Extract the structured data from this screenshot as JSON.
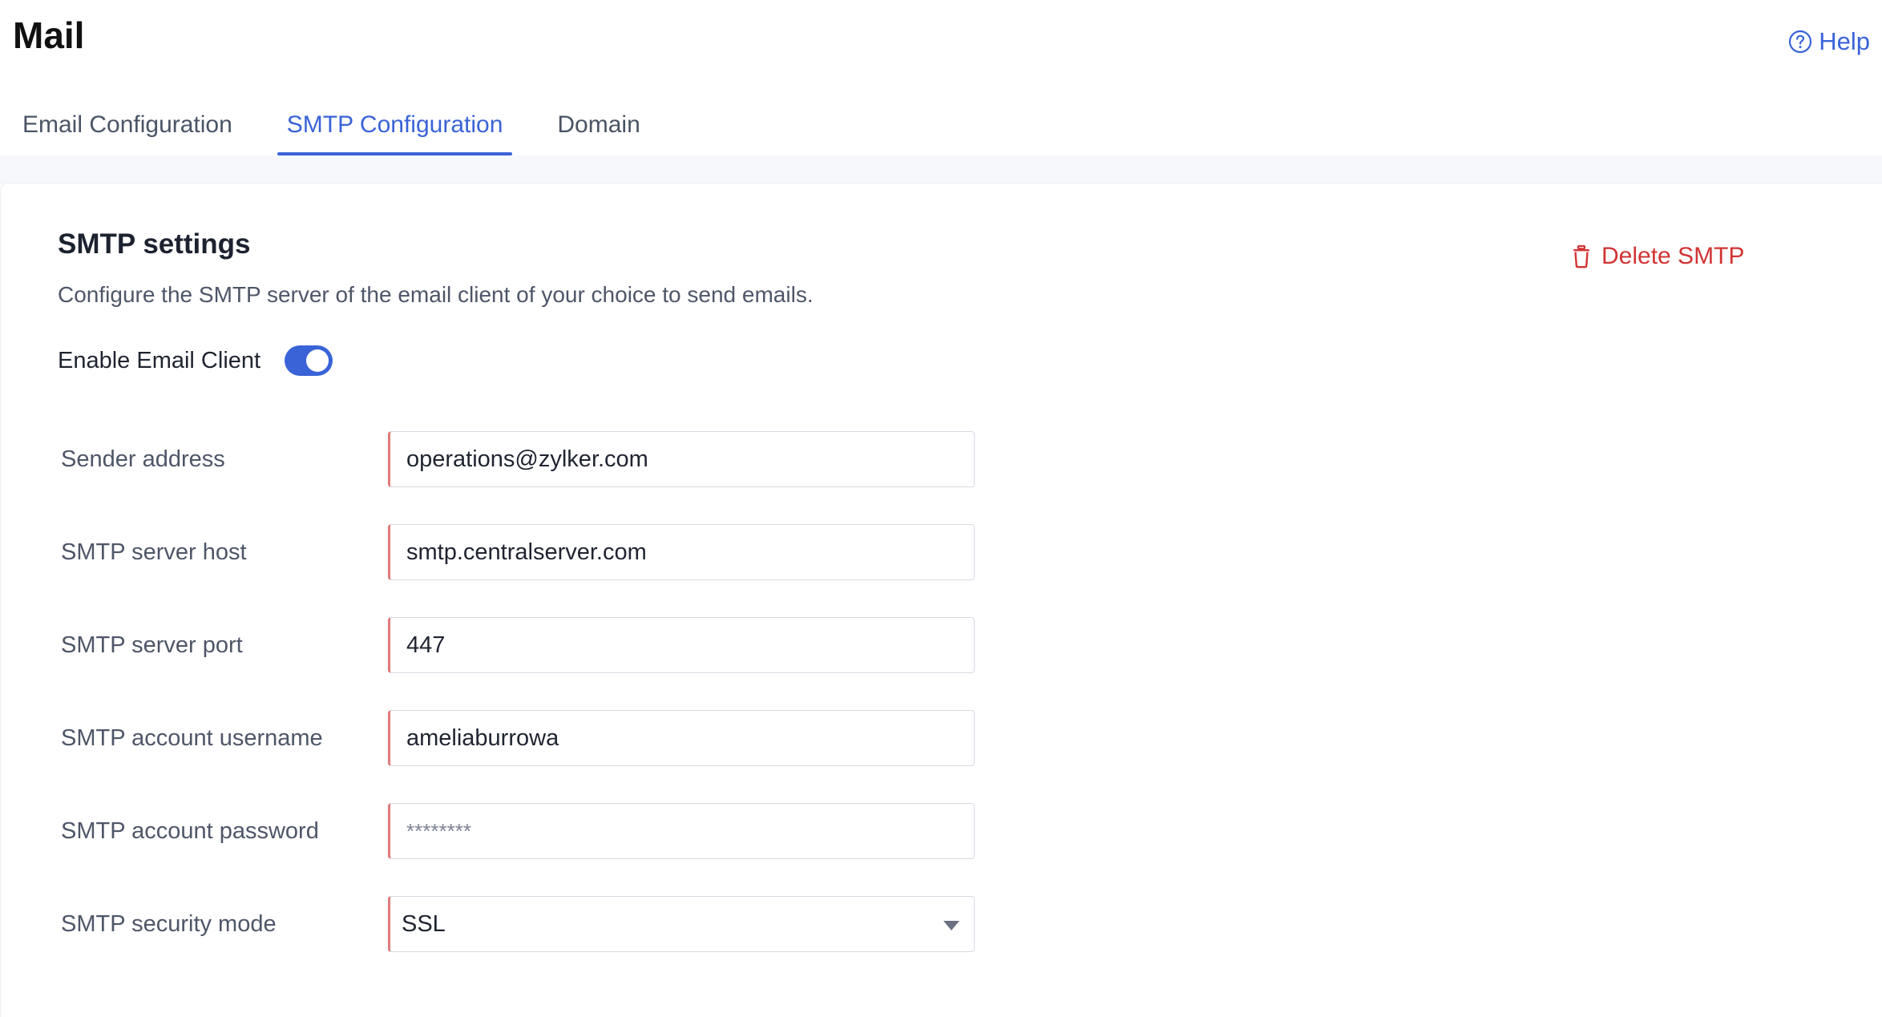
{
  "page": {
    "title": "Mail",
    "help_label": "Help"
  },
  "tabs": [
    {
      "label": "Email Configuration",
      "active": false
    },
    {
      "label": "SMTP Configuration",
      "active": true
    },
    {
      "label": "Domain",
      "active": false
    }
  ],
  "section": {
    "title": "SMTP settings",
    "description": "Configure the SMTP server of the email client of your choice to send emails.",
    "delete_label": "Delete SMTP"
  },
  "toggle": {
    "label": "Enable Email Client",
    "enabled": true
  },
  "form": {
    "sender_address": {
      "label": "Sender address",
      "value": "operations@zylker.com"
    },
    "server_host": {
      "label": "SMTP server host",
      "value": "smtp.centralserver.com"
    },
    "server_port": {
      "label": "SMTP server port",
      "value": "447"
    },
    "username": {
      "label": "SMTP account username",
      "value": "ameliaburrowa"
    },
    "password": {
      "label": "SMTP account password",
      "value": "",
      "placeholder": "********"
    },
    "security_mode": {
      "label": "SMTP security mode",
      "value": "SSL"
    }
  },
  "colors": {
    "accent": "#3a63d8",
    "danger": "#d13434",
    "required_marker": "#e07a7a"
  },
  "icons": {
    "help": "help-circle-icon",
    "delete": "trash-icon",
    "dropdown": "chevron-down-icon"
  }
}
